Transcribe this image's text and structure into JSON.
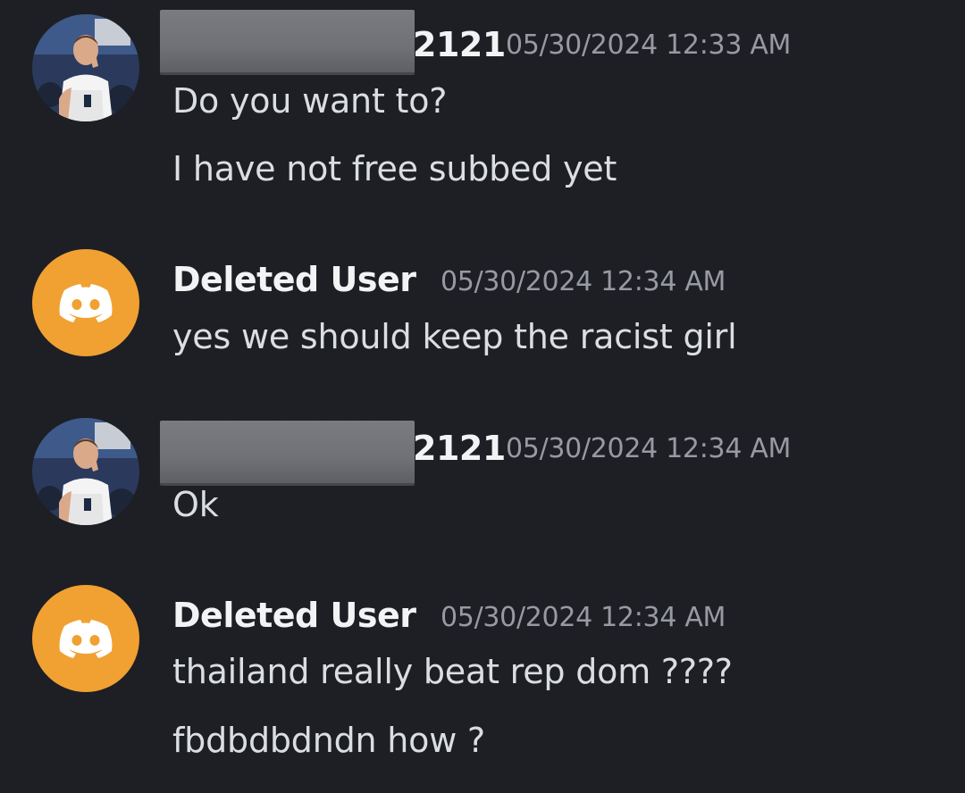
{
  "messages": [
    {
      "author_visible": "2121",
      "author_redacted": true,
      "avatar": "player-photo",
      "timestamp": "05/30/2024 12:33 AM",
      "lines": [
        "Do you want to?",
        "I have not free subbed yet"
      ]
    },
    {
      "author_visible": "Deleted User",
      "author_redacted": false,
      "avatar": "discord-logo-icon",
      "timestamp": "05/30/2024 12:34 AM",
      "lines": [
        "yes we should keep the racist girl"
      ]
    },
    {
      "author_visible": "2121",
      "author_redacted": true,
      "avatar": "player-photo",
      "timestamp": "05/30/2024 12:34 AM",
      "lines": [
        "Ok"
      ]
    },
    {
      "author_visible": "Deleted User",
      "author_redacted": false,
      "avatar": "discord-logo-icon",
      "timestamp": "05/30/2024 12:34 AM",
      "lines": [
        "thailand really beat rep dom ????",
        "fbdbdbdndn how ?"
      ]
    }
  ],
  "colors": {
    "background": "#1e1f24",
    "username": "#f2f3f5",
    "message_text": "#dbdee1",
    "timestamp": "#989aa2",
    "deleted_user_avatar": "#f0a132",
    "redaction_box": "#707176"
  }
}
